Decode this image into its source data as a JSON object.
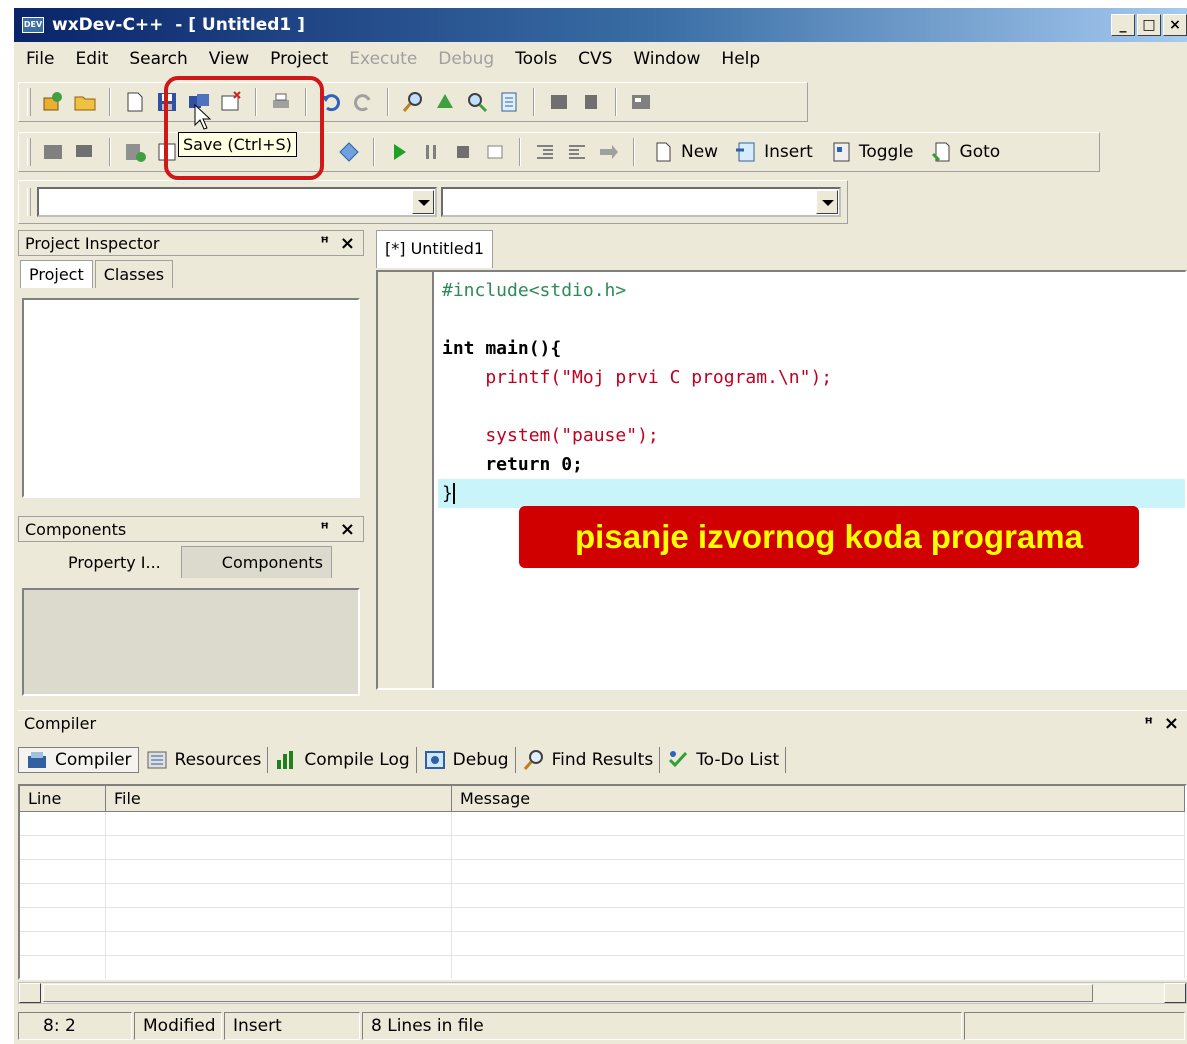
{
  "window": {
    "title": "wxDev-C++  - [ Untitled1 ]",
    "minimize": "_",
    "maximize": "□",
    "close": "×"
  },
  "menu": {
    "items": [
      {
        "label": "File",
        "enabled": true
      },
      {
        "label": "Edit",
        "enabled": true
      },
      {
        "label": "Search",
        "enabled": true
      },
      {
        "label": "View",
        "enabled": true
      },
      {
        "label": "Project",
        "enabled": true
      },
      {
        "label": "Execute",
        "enabled": false
      },
      {
        "label": "Debug",
        "enabled": false
      },
      {
        "label": "Tools",
        "enabled": true
      },
      {
        "label": "CVS",
        "enabled": true
      },
      {
        "label": "Window",
        "enabled": true
      },
      {
        "label": "Help",
        "enabled": true
      }
    ]
  },
  "toolbar2": {
    "new_label": "New",
    "insert_label": "Insert",
    "toggle_label": "Toggle",
    "goto_label": "Goto"
  },
  "tooltip": "Save (Ctrl+S)",
  "project_inspector": {
    "title": "Project Inspector",
    "tab_project": "Project",
    "tab_classes": "Classes"
  },
  "components_panel": {
    "title": "Components",
    "tab_property": "Property I...",
    "tab_components": "Components"
  },
  "panel_pin": "ꟸ",
  "panel_close": "×",
  "editor": {
    "tab": "[*] Untitled1",
    "lines": [
      "#include<stdio.h>",
      "",
      "int main(){",
      "    printf(\"Moj prvi C program.\\n\");",
      "",
      "    system(\"pause\");",
      "    return 0;",
      "}"
    ],
    "current_line": 8
  },
  "annotation": "pisanje izvornog koda programa",
  "compiler": {
    "title": "Compiler",
    "tabs": [
      "Compiler",
      "Resources",
      "Compile Log",
      "Debug",
      "Find Results",
      "To-Do List"
    ],
    "columns": [
      "Line",
      "File",
      "Message"
    ]
  },
  "status": {
    "position": "8: 2",
    "modified": "Modified",
    "mode": "Insert",
    "lines": "8 Lines in file"
  },
  "colors": {
    "accent_red": "#d00000",
    "annotation_text": "#ffff00",
    "current_line_bg": "#c8f4fa"
  }
}
